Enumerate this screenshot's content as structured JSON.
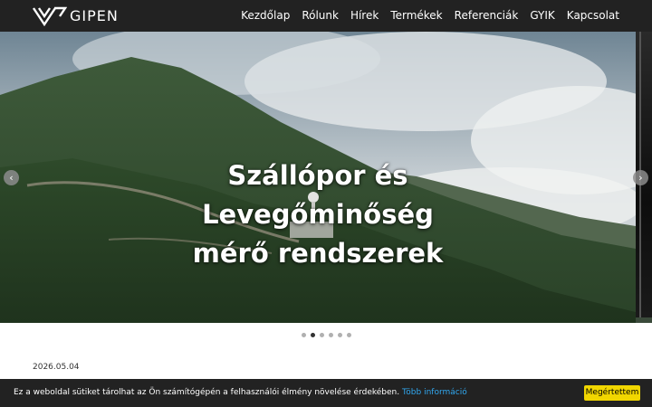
{
  "header": {
    "logo_text": "GIPEN",
    "nav": [
      "Kezdőlap",
      "Rólunk",
      "Hírek",
      "Termékek",
      "Referenciák",
      "GYIK",
      "Kapcsolat"
    ]
  },
  "slider": {
    "caption_lines": [
      "Szállópor és",
      "Levegőminőség",
      "mérő rendszerek"
    ],
    "prev_icon": "chevron-left-icon",
    "next_icon": "chevron-right-icon",
    "dot_count": 6,
    "active_dot": 2
  },
  "main": {
    "date": "2026.05.04"
  },
  "cookie": {
    "text": "Ez a weboldal sütiket tárolhat az Ön számítógépén a felhasználói élmény növelése érdekében.",
    "link": "Több információ",
    "button": "Megértettem"
  },
  "colors": {
    "navbar_bg": "#222222",
    "cookie_bg": "#222222",
    "cookie_button": "#f1d600",
    "cookie_link": "#31a8f0"
  }
}
